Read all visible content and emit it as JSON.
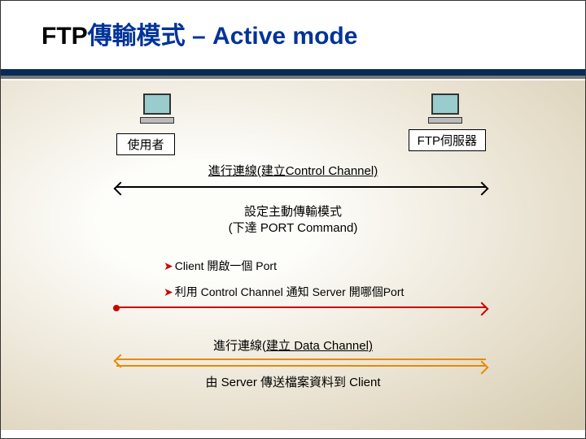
{
  "title": {
    "prefix": "FTP",
    "zh": "傳輸模式",
    "suffix": " – Active mode"
  },
  "endpoints": {
    "user": "使用者",
    "server": "FTP伺服器"
  },
  "captions": {
    "control_channel": "進行連線(建立Control Channel)",
    "set_active_l1": "設定主動傳輸模式",
    "set_active_l2": "(下達 PORT Command)",
    "data_channel_pre": "進行連線(",
    "data_channel_link": "建立 Data Channel)",
    "server_to_client": "由 Server 傳送檔案資料到 Client"
  },
  "bullets": {
    "b1": "Client 開啟一個 Port",
    "b2": "利用 Control Channel 通知 Server 開哪個Port"
  },
  "chart_data": {
    "type": "table",
    "description": "FTP Active mode sequence between client (使用者) and FTP server (FTP伺服器)",
    "steps": [
      {
        "from": "client",
        "to": "server",
        "bidirectional": true,
        "color": "black",
        "label": "進行連線(建立Control Channel)"
      },
      {
        "note": "設定主動傳輸模式 (下達 PORT Command)"
      },
      {
        "note": "Client 開啟一個 Port"
      },
      {
        "from": "client",
        "to": "server",
        "bidirectional": false,
        "color": "red",
        "label": "利用 Control Channel 通知 Server 開哪個Port"
      },
      {
        "from": "server",
        "to": "client",
        "bidirectional": false,
        "color": "orange",
        "label": "進行連線(建立 Data Channel)"
      },
      {
        "from": "client",
        "to": "server",
        "bidirectional": false,
        "color": "orange",
        "label": ""
      },
      {
        "note": "由 Server 傳送檔案資料到 Client"
      }
    ]
  }
}
